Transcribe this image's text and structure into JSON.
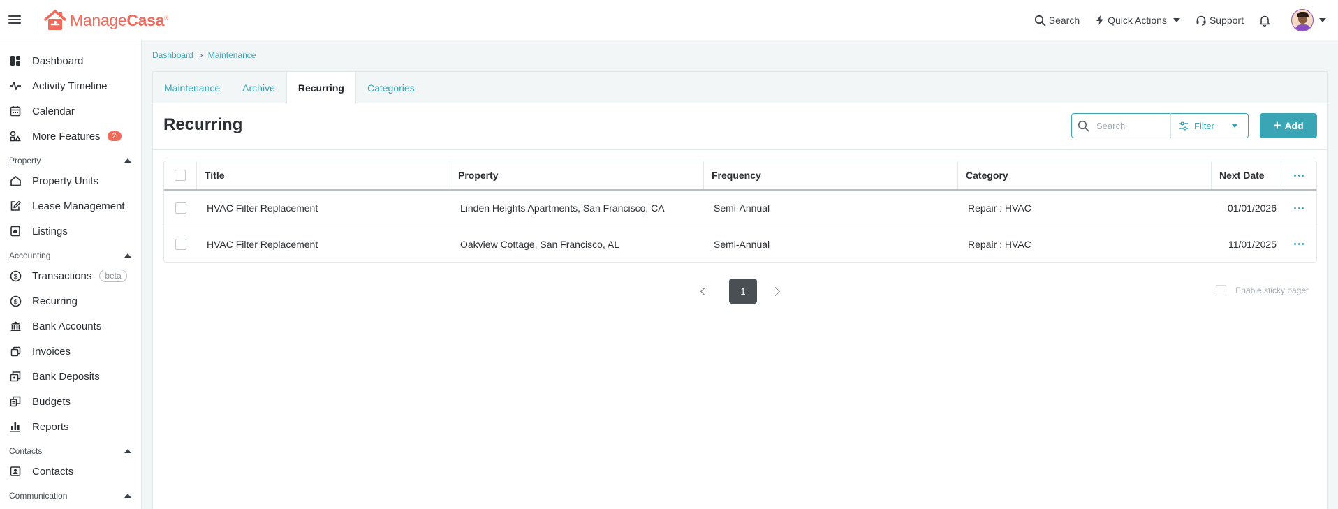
{
  "app": {
    "name_part1": "Manage",
    "name_part2": "Casa",
    "reg": "®"
  },
  "topnav": {
    "search": "Search",
    "quick_actions": "Quick Actions",
    "support": "Support"
  },
  "sidebar": {
    "items": [
      {
        "label": "Dashboard",
        "icon": "dashboard-icon"
      },
      {
        "label": "Activity Timeline",
        "icon": "activity-icon"
      },
      {
        "label": "Calendar",
        "icon": "calendar-icon"
      },
      {
        "label": "More Features",
        "icon": "features-icon",
        "badge": "2"
      }
    ],
    "sections": [
      {
        "title": "Property",
        "items": [
          {
            "label": "Property Units",
            "icon": "home-icon"
          },
          {
            "label": "Lease Management",
            "icon": "lease-icon"
          },
          {
            "label": "Listings",
            "icon": "listings-icon"
          }
        ]
      },
      {
        "title": "Accounting",
        "items": [
          {
            "label": "Transactions",
            "icon": "dollar-icon",
            "tag": "beta"
          },
          {
            "label": "Recurring",
            "icon": "recurring-icon"
          },
          {
            "label": "Bank Accounts",
            "icon": "bank-icon"
          },
          {
            "label": "Invoices",
            "icon": "invoice-icon"
          },
          {
            "label": "Bank Deposits",
            "icon": "deposit-icon"
          },
          {
            "label": "Budgets",
            "icon": "budget-icon"
          },
          {
            "label": "Reports",
            "icon": "reports-icon"
          }
        ]
      },
      {
        "title": "Contacts",
        "items": [
          {
            "label": "Contacts",
            "icon": "contacts-icon"
          }
        ]
      },
      {
        "title": "Communication",
        "items": []
      }
    ]
  },
  "breadcrumb": {
    "items": [
      "Dashboard",
      "Maintenance"
    ]
  },
  "tabs": [
    "Maintenance",
    "Archive",
    "Recurring",
    "Categories"
  ],
  "page": {
    "title": "Recurring",
    "search_placeholder": "Search",
    "filter_label": "Filter",
    "add_label": "Add"
  },
  "table": {
    "columns": [
      "Title",
      "Property",
      "Frequency",
      "Category",
      "Next Date"
    ],
    "rows": [
      [
        "HVAC Filter Replacement",
        "Linden Heights Apartments, San Francisco, CA",
        "Semi-Annual",
        "Repair : HVAC",
        "01/01/2026"
      ],
      [
        "HVAC Filter Replacement",
        "Oakview Cottage, San Francisco, AL",
        "Semi-Annual",
        "Repair : HVAC",
        "11/01/2025"
      ]
    ]
  },
  "pager": {
    "current_page": "1",
    "sticky_label": "Enable sticky pager"
  },
  "colors": {
    "accent": "#3aa6b5",
    "brand": "#ef6b5b",
    "badge": "#ef6b5b"
  }
}
